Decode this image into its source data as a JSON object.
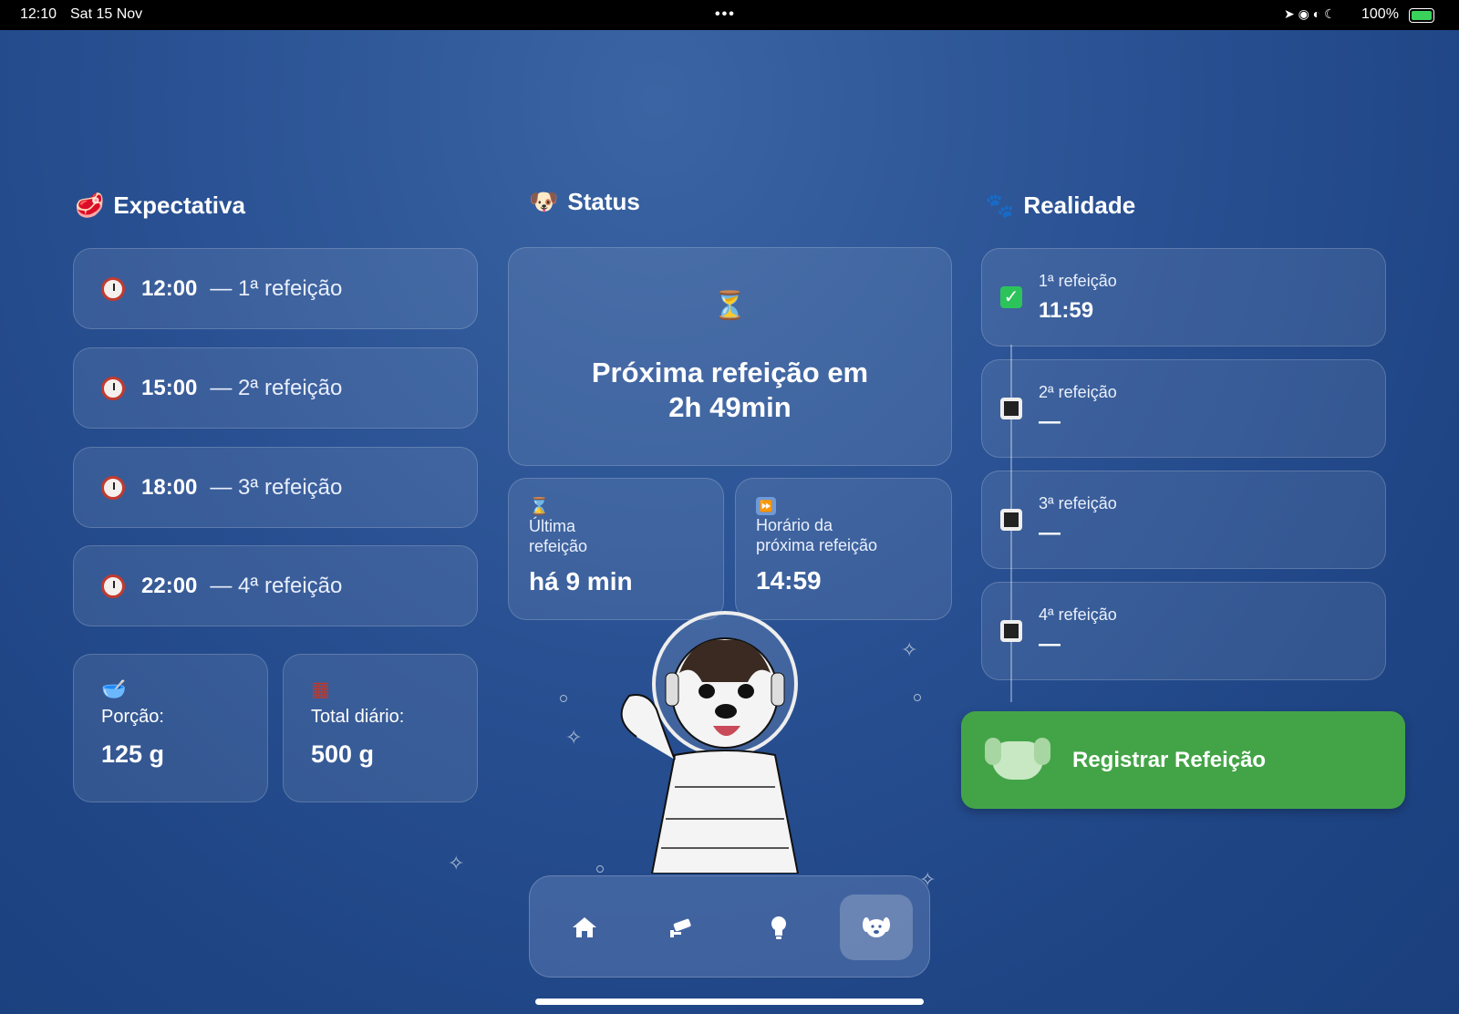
{
  "status_bar": {
    "time": "12:10",
    "date": "Sat 15 Nov",
    "dots": "•••",
    "icons": "➤ ◉ ◐ ☾",
    "battery": "100%"
  },
  "expectativa": {
    "title": "Expectativa",
    "icon": "meat-icon",
    "meals": [
      {
        "time": "12:00",
        "label": "— 1ª refeição"
      },
      {
        "time": "15:00",
        "label": "— 2ª refeição"
      },
      {
        "time": "18:00",
        "label": "— 3ª refeição"
      },
      {
        "time": "22:00",
        "label": "— 4ª refeição"
      }
    ],
    "portion_label": "Porção:",
    "portion_value": "125 g",
    "daily_label": "Total diário:",
    "daily_value": "500 g"
  },
  "status": {
    "title": "Status",
    "icon": "dog-face-icon",
    "next_line1": "Próxima refeição em",
    "next_line2": "2h 49min",
    "last_label_1": "Última",
    "last_label_2": "refeição",
    "last_value": "há 9 min",
    "next_time_label_1": "Horário da",
    "next_time_label_2": "próxima refeição",
    "next_time_value": "14:59"
  },
  "realidade": {
    "title": "Realidade",
    "icon": "paw-prints-icon",
    "entries": [
      {
        "label": "1ª refeição",
        "value": "11:59",
        "done": true
      },
      {
        "label": "2ª refeição",
        "value": "—",
        "done": false
      },
      {
        "label": "3ª refeição",
        "value": "—",
        "done": false
      },
      {
        "label": "4ª refeição",
        "value": "—",
        "done": false
      }
    ]
  },
  "register_button": {
    "label": "Registrar Refeição"
  },
  "tabs": [
    {
      "name": "home",
      "icon": "home-icon",
      "active": false
    },
    {
      "name": "camera",
      "icon": "security-camera-icon",
      "active": false
    },
    {
      "name": "light",
      "icon": "lightbulb-icon",
      "active": false
    },
    {
      "name": "dog",
      "icon": "dog-icon",
      "active": true
    }
  ],
  "colors": {
    "bg": "#2a5294",
    "register": "#43a447",
    "check": "#2cc45a"
  }
}
